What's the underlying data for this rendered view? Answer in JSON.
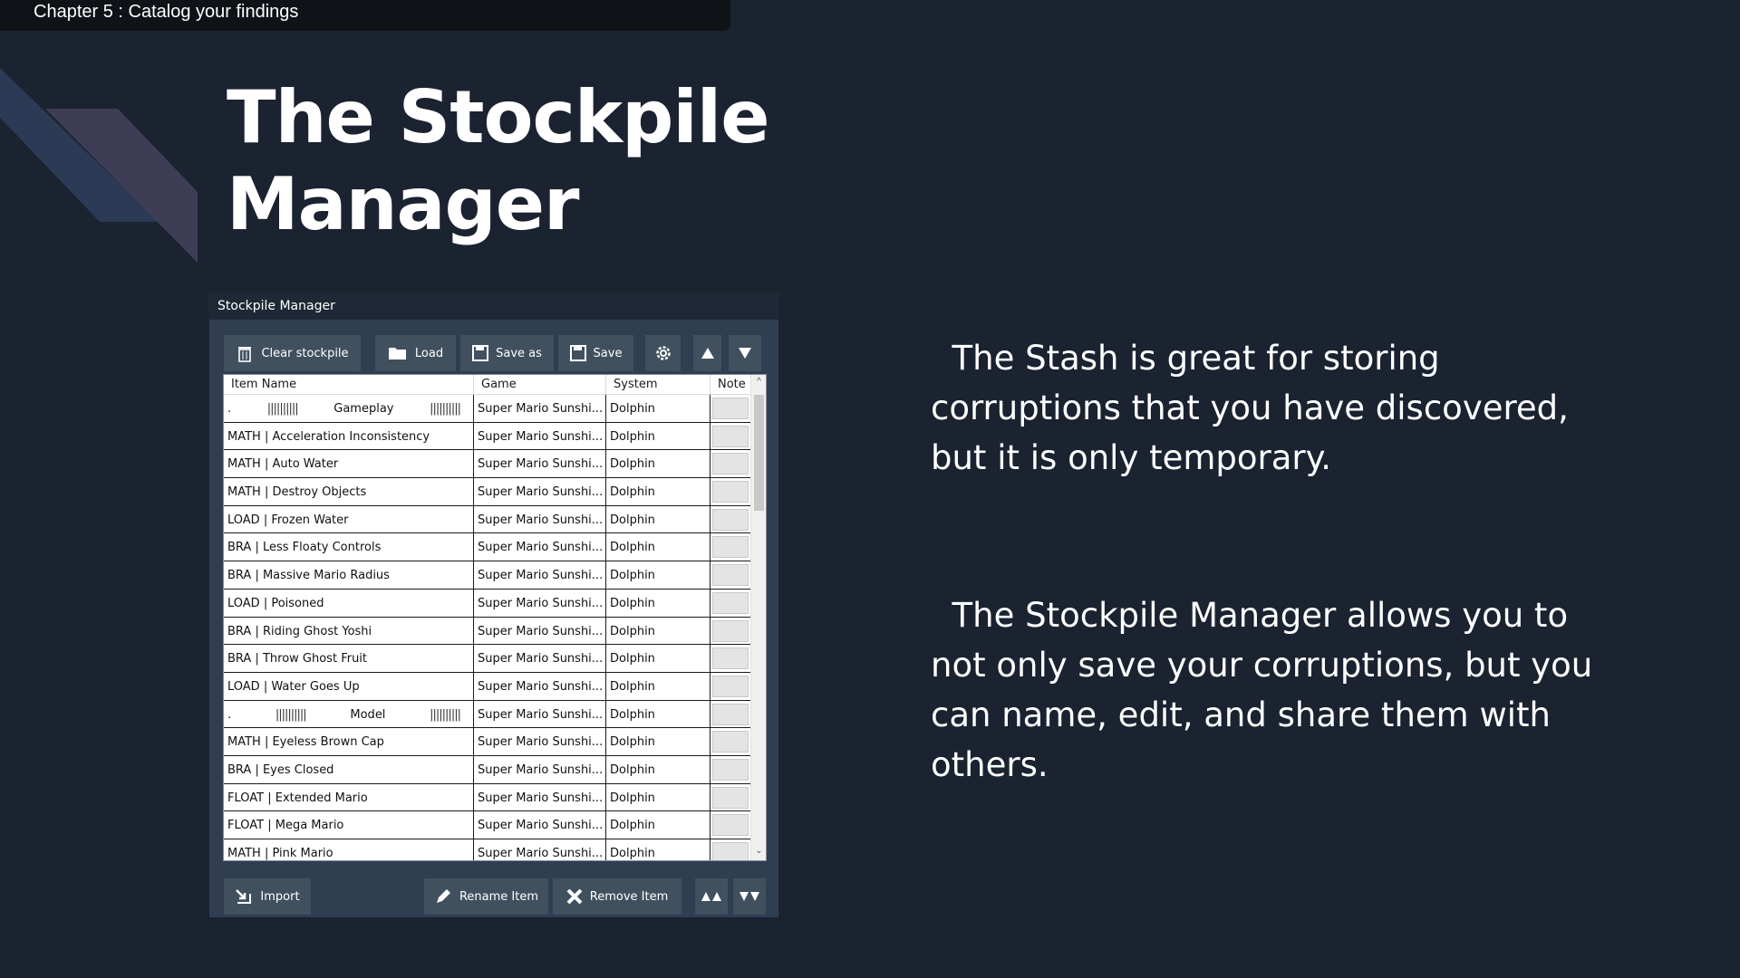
{
  "chapter": "Chapter 5 : Catalog your findings",
  "title_line1": "The Stockpile",
  "title_line2": "Manager",
  "paragraph1": "  The Stash is great for storing corruptions that you have discovered, but it is only temporary.",
  "paragraph2": "  The Stockpile Manager allows you to not only save your corruptions, but you can name, edit, and share them with others.",
  "window": {
    "title": "Stockpile Manager",
    "toolbar": {
      "clear": "Clear stockpile",
      "load": "Load",
      "save_as": "Save as",
      "save": "Save",
      "settings_icon": "gear-icon",
      "up_icon": "triangle-up-icon",
      "down_icon": "triangle-down-icon"
    },
    "columns": [
      "Item Name",
      "Game",
      "System",
      "Note"
    ],
    "rows": [
      {
        "name": "Gameplay",
        "separator": true,
        "dot": ".",
        "bars": "||||||||||",
        "game": "Super Mario Sunshi...",
        "system": "Dolphin"
      },
      {
        "name": "MATH | Acceleration Inconsistency",
        "game": "Super Mario Sunshi...",
        "system": "Dolphin"
      },
      {
        "name": "MATH | Auto Water",
        "game": "Super Mario Sunshi...",
        "system": "Dolphin"
      },
      {
        "name": "MATH | Destroy Objects",
        "game": "Super Mario Sunshi...",
        "system": "Dolphin"
      },
      {
        "name": "LOAD | Frozen Water",
        "game": "Super Mario Sunshi...",
        "system": "Dolphin"
      },
      {
        "name": "BRA | Less Floaty Controls",
        "game": "Super Mario Sunshi...",
        "system": "Dolphin"
      },
      {
        "name": "BRA | Massive Mario Radius",
        "game": "Super Mario Sunshi...",
        "system": "Dolphin"
      },
      {
        "name": "LOAD | Poisoned",
        "game": "Super Mario Sunshi...",
        "system": "Dolphin"
      },
      {
        "name": "BRA | Riding Ghost Yoshi",
        "game": "Super Mario Sunshi...",
        "system": "Dolphin"
      },
      {
        "name": "BRA | Throw Ghost Fruit",
        "game": "Super Mario Sunshi...",
        "system": "Dolphin"
      },
      {
        "name": "LOAD | Water Goes Up",
        "game": "Super Mario Sunshi...",
        "system": "Dolphin"
      },
      {
        "name": "Model",
        "separator": true,
        "dot": ".",
        "bars": "||||||||||",
        "game": "Super Mario Sunshi...",
        "system": "Dolphin"
      },
      {
        "name": "MATH | Eyeless Brown Cap",
        "game": "Super Mario Sunshi...",
        "system": "Dolphin"
      },
      {
        "name": "BRA | Eyes Closed",
        "game": "Super Mario Sunshi...",
        "system": "Dolphin"
      },
      {
        "name": "FLOAT | Extended Mario",
        "game": "Super Mario Sunshi...",
        "system": "Dolphin"
      },
      {
        "name": "FLOAT | Mega Mario",
        "game": "Super Mario Sunshi...",
        "system": "Dolphin"
      },
      {
        "name": "MATH | Pink Mario",
        "game": "Super Mario Sunshi...",
        "system": "Dolphin"
      }
    ],
    "bottom": {
      "import": "Import",
      "rename": "Rename Item",
      "remove": "Remove Item",
      "top_icon": "double-up-icon",
      "bottom_icon": "double-down-icon"
    }
  },
  "colors": {
    "background": "#1b2230",
    "panel": "#303e52",
    "button": "#41505f",
    "chapter_bar": "#0f1318"
  }
}
